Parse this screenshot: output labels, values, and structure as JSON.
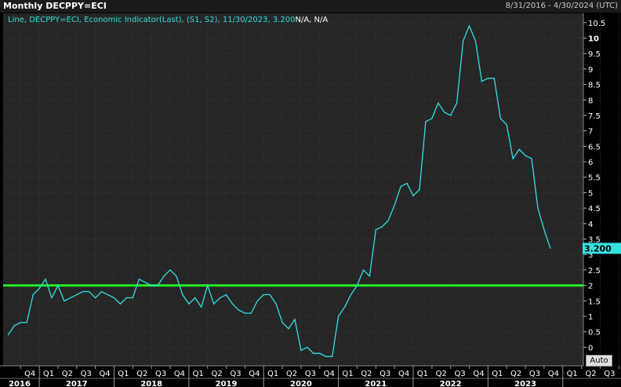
{
  "header": {
    "title": "Monthly DECPPY=ECI",
    "date_range": "8/31/2016 - 4/30/2024 (UTC)"
  },
  "legend": {
    "series_text": "Line, DECPPY=ECI, Economic Indicator(Last), (S1, S2), 11/30/2023, 3.200",
    "na_text": "N/A, N/A"
  },
  "controls": {
    "auto_label": "Auto"
  },
  "colors": {
    "background": "#000000",
    "plot_bg": "#262626",
    "grid": "#3a3a3a",
    "series": "#35e0e0",
    "reference_line": "#22ee22",
    "last_value_tag": "#35e0e0"
  },
  "chart_data": {
    "type": "line",
    "x_start": "2016-08",
    "x_end": "2024-04",
    "ylim": [
      -0.6,
      10.8
    ],
    "yticks": [
      0,
      0.5,
      1,
      1.5,
      2,
      2.5,
      3,
      3.5,
      4,
      4.5,
      5,
      5.5,
      6,
      6.5,
      7,
      7.5,
      8,
      8.5,
      9,
      9.5,
      10,
      10.5
    ],
    "bold_ytick": 10,
    "grid": true,
    "last_value_label": "3.200",
    "reference_line": {
      "y": 2.0
    },
    "quarter_labels": [
      "Q4",
      "Q1",
      "Q2",
      "Q3",
      "Q4",
      "Q1",
      "Q2",
      "Q3",
      "Q4",
      "Q1",
      "Q2",
      "Q3",
      "Q4",
      "Q1",
      "Q2",
      "Q3",
      "Q4",
      "Q1",
      "Q2",
      "Q3",
      "Q4",
      "Q1",
      "Q2",
      "Q3",
      "Q4",
      "Q1",
      "Q2",
      "Q3",
      "Q4",
      "Q1",
      "Q2",
      "Q3",
      "Q4",
      "Q1",
      "Q2"
    ],
    "year_labels": [
      "2016",
      "2017",
      "2018",
      "2019",
      "2020",
      "2021",
      "2022",
      "2023"
    ],
    "series": [
      {
        "x": [
          "2016-08",
          "2016-09",
          "2016-10",
          "2016-11",
          "2016-12",
          "2017-01",
          "2017-02",
          "2017-03",
          "2017-04",
          "2017-05",
          "2017-06",
          "2017-07",
          "2017-08",
          "2017-09",
          "2017-10",
          "2017-11",
          "2017-12",
          "2018-01",
          "2018-02",
          "2018-03",
          "2018-04",
          "2018-05",
          "2018-06",
          "2018-07",
          "2018-08",
          "2018-09",
          "2018-10",
          "2018-11",
          "2018-12",
          "2019-01",
          "2019-02",
          "2019-03",
          "2019-04",
          "2019-05",
          "2019-06",
          "2019-07",
          "2019-08",
          "2019-09",
          "2019-10",
          "2019-11",
          "2019-12",
          "2020-01",
          "2020-02",
          "2020-03",
          "2020-04",
          "2020-05",
          "2020-06",
          "2020-07",
          "2020-08",
          "2020-09",
          "2020-10",
          "2020-11",
          "2020-12",
          "2021-01",
          "2021-02",
          "2021-03",
          "2021-04",
          "2021-05",
          "2021-06",
          "2021-07",
          "2021-08",
          "2021-09",
          "2021-10",
          "2021-11",
          "2021-12",
          "2022-01",
          "2022-02",
          "2022-03",
          "2022-04",
          "2022-05",
          "2022-06",
          "2022-07",
          "2022-08",
          "2022-09",
          "2022-10",
          "2022-11",
          "2022-12",
          "2023-01",
          "2023-02",
          "2023-03",
          "2023-04",
          "2023-05",
          "2023-06",
          "2023-07",
          "2023-08",
          "2023-09",
          "2023-10",
          "2023-11"
        ],
        "y": [
          0.4,
          0.7,
          0.8,
          0.8,
          1.7,
          1.9,
          2.2,
          1.6,
          2.0,
          1.5,
          1.6,
          1.7,
          1.8,
          1.8,
          1.6,
          1.8,
          1.7,
          1.6,
          1.4,
          1.6,
          1.6,
          2.2,
          2.1,
          2.0,
          2.0,
          2.3,
          2.5,
          2.3,
          1.7,
          1.4,
          1.6,
          1.3,
          2.0,
          1.4,
          1.6,
          1.7,
          1.4,
          1.2,
          1.1,
          1.1,
          1.5,
          1.7,
          1.7,
          1.4,
          0.8,
          0.6,
          0.9,
          -0.1,
          0.0,
          -0.2,
          -0.2,
          -0.3,
          -0.3,
          1.0,
          1.3,
          1.7,
          2.0,
          2.5,
          2.3,
          3.8,
          3.9,
          4.1,
          4.6,
          5.2,
          5.3,
          4.9,
          5.1,
          7.3,
          7.4,
          7.9,
          7.6,
          7.5,
          7.9,
          9.9,
          10.4,
          9.9,
          8.6,
          8.7,
          8.7,
          7.4,
          7.2,
          6.1,
          6.4,
          6.2,
          6.1,
          4.5,
          3.8,
          3.2
        ]
      }
    ]
  }
}
